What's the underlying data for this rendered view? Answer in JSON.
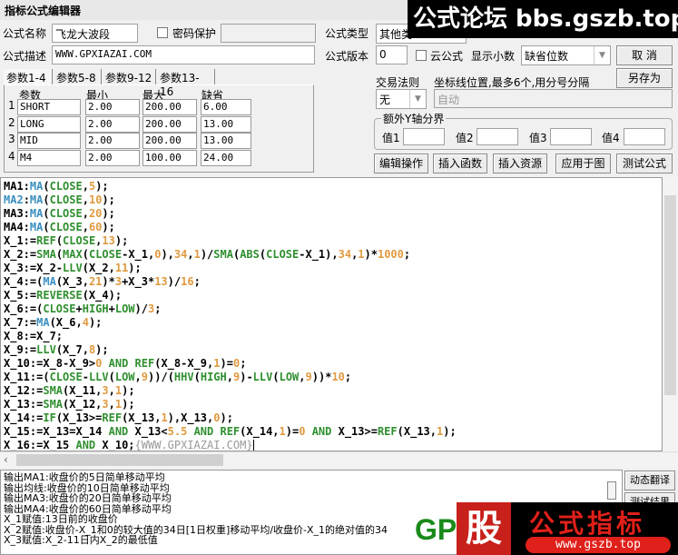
{
  "window": {
    "title": "指标公式编辑器"
  },
  "form": {
    "name_label": "公式名称",
    "name_value": "飞龙大波段",
    "password_label": "密码保护",
    "password_value": "",
    "type_label": "公式类型",
    "type_value": "其他类",
    "desc_label": "公式描述",
    "desc_value": "WWW.GPXIAZAI.COM",
    "version_label": "公式版本",
    "version_value": "0",
    "cloud_label": "云公式",
    "decimal_label": "显示小数",
    "decimal_value": "缺省位数",
    "trade_rule_label": "交易法则",
    "trade_rule_value": "无",
    "axis_label": "坐标线位置,最多6个,用分号分隔",
    "axis_placeholder": "自动",
    "yaxis_group": "额外Y轴分界",
    "y1": "值1",
    "y2": "值2",
    "y3": "值3",
    "y4": "值4"
  },
  "buttons": {
    "cancel": "取  消",
    "save_as": "另存为",
    "edit": "编辑操作",
    "insert_func": "插入函数",
    "insert_res": "插入资源",
    "apply": "应用于图",
    "test": "测试公式",
    "dyn_translate": "动态翻译",
    "test_result": "测试结果"
  },
  "tabs": [
    "参数1-4",
    "参数5-8",
    "参数9-12",
    "参数13-16"
  ],
  "params": {
    "headers": [
      "参数",
      "最小",
      "最大",
      "缺省"
    ],
    "rows": [
      {
        "idx": "1",
        "name": "SHORT",
        "min": "2.00",
        "max": "200.00",
        "def": "6.00"
      },
      {
        "idx": "2",
        "name": "LONG",
        "min": "2.00",
        "max": "200.00",
        "def": "13.00"
      },
      {
        "idx": "3",
        "name": "MID",
        "min": "2.00",
        "max": "200.00",
        "def": "13.00"
      },
      {
        "idx": "4",
        "name": "M4",
        "min": "2.00",
        "max": "100.00",
        "def": "24.00"
      }
    ]
  },
  "code": [
    "MA1:MA(CLOSE,5);",
    "MA2:MA(CLOSE,10);",
    "MA3:MA(CLOSE,20);",
    "MA4:MA(CLOSE,60);",
    "X_1:=REF(CLOSE,13);",
    "X_2:=SMA(MAX(CLOSE-X_1,0),34,1)/SMA(ABS(CLOSE-X_1),34,1)*1000;",
    "X_3:=X_2-LLV(X_2,11);",
    "X_4:=(MA(X_3,21)*3+X_3*13)/16;",
    "X_5:=REVERSE(X_4);",
    "X_6:=(CLOSE+HIGH+LOW)/3;",
    "X_7:=MA(X_6,4);",
    "X_8:=X_7;",
    "X_9:=LLV(X_7,8);",
    "X_10:=X_8-X_9>0 AND REF(X_8-X_9,1)=0;",
    "X_11:=(CLOSE-LLV(LOW,9))/(HHV(HIGH,9)-LLV(LOW,9))*10;",
    "X_12:=SMA(X_11,3,1);",
    "X_13:=SMA(X_12,3,1);",
    "X_14:=IF(X_13>=REF(X_13,1),X_13,0);",
    "X_15:=X_13=X_14 AND X_13<5.5 AND REF(X_14,1)=0 AND X_13>=REF(X_13,1);",
    "X_16:=X_15 AND X_10;{WWW.GPXIAZAI.COM}"
  ],
  "output": [
    "输出MA1:收盘价的5日简单移动平均",
    "输出均线:收盘价的10日简单移动平均",
    "输出MA3:收盘价的20日简单移动平均",
    "输出MA4:收盘价的60日简单移动平均",
    "X_1赋值:13日前的收盘价",
    "X_2赋值:收盘价-X_1和0的较大值的34日[1日权重]移动平均/收盘价-X_1的绝对值的34",
    "X_3赋值:X_2-11日内X_2的最低值"
  ],
  "watermarks": {
    "top": "公式论坛 bbs.gszb.top",
    "bottom_logo": "GP",
    "bottom_big": "股",
    "bottom_text": "公式指标",
    "bottom_url": "www.gszb.top"
  }
}
